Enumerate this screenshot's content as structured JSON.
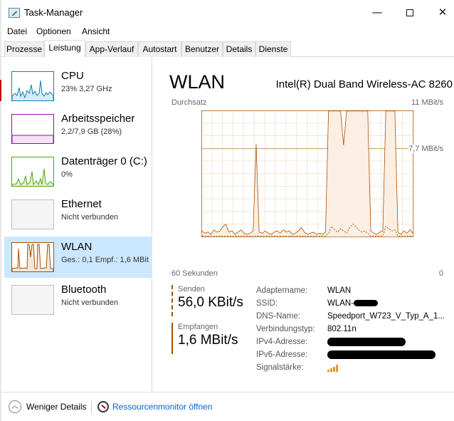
{
  "window": {
    "title": "Task-Manager",
    "minimize": "—",
    "close": "✕"
  },
  "menu": [
    "Datei",
    "Optionen",
    "Ansicht"
  ],
  "tabs": [
    "Prozesse",
    "Leistung",
    "App-Verlauf",
    "Autostart",
    "Benutzer",
    "Details",
    "Dienste"
  ],
  "active_tab": "Leistung",
  "sidebar": [
    {
      "title": "CPU",
      "sub": "23%  3,27 GHz",
      "thumb": "cpu",
      "color": "#117dbb"
    },
    {
      "title": "Arbeitsspeicher",
      "sub": "2,2/7,9 GB (28%)",
      "thumb": "mem",
      "color": "#8b12ae"
    },
    {
      "title": "Datenträger 0 (C:)",
      "sub": "0%",
      "thumb": "disk",
      "color": "#4da60c"
    },
    {
      "title": "Ethernet",
      "sub": "Nicht verbunden",
      "thumb": "none",
      "color": "#bfbfbf"
    },
    {
      "title": "WLAN",
      "sub": "Ges.: 0,1  Empf.: 1,6 MBit",
      "thumb": "wlan",
      "color": "#a74f01",
      "selected": true
    },
    {
      "title": "Bluetooth",
      "sub": "Nicht verbunden",
      "thumb": "none",
      "color": "#bfbfbf"
    }
  ],
  "main": {
    "title": "WLAN",
    "adapter_name": "Intel(R) Dual Band Wireless-AC 8260",
    "throughput_label": "Durchsatz",
    "max_label": "11 MBit/s",
    "mid_label": "7,7 MBit/s",
    "time_label": "60 Sekunden",
    "zero_label": "0",
    "send_label": "Senden",
    "send_value": "56,0 KBit/s",
    "recv_label": "Empfangen",
    "recv_value": "1,6 MBit/s"
  },
  "properties": [
    {
      "key": "Adaptername:",
      "value": "WLAN"
    },
    {
      "key": "SSID:",
      "value": "WLAN-",
      "redacted": true
    },
    {
      "key": "DNS-Name:",
      "value": "Speedport_W723_V_Typ_A_1..."
    },
    {
      "key": "Verbindungstyp:",
      "value": "802.11n"
    },
    {
      "key": "IPv4-Adresse:",
      "value": "",
      "redacted": true
    },
    {
      "key": "IPv6-Adresse:",
      "value": "",
      "redacted": true
    },
    {
      "key": "Signalstärke:",
      "value": "",
      "signal_bars": 4
    }
  ],
  "graph": {
    "max_mbit": 11,
    "receive": [
      0.5,
      0.3,
      0.4,
      0.2,
      0.6,
      0.4,
      0.5,
      0.9,
      1.1,
      0.4,
      0.5,
      0.2,
      0.4,
      0.6,
      0.3,
      0.2,
      0.3,
      0.5,
      8.1,
      0.4,
      0.3,
      0.5,
      0.3,
      0.2,
      0.4,
      0.5,
      0.3,
      0.6,
      0.4,
      0.5,
      0.2,
      0.3,
      0.5,
      0.8,
      0.4,
      0.2,
      0.3,
      0.4,
      0.2,
      0.3,
      0.2,
      0.4,
      11,
      11,
      11,
      11,
      11,
      8.0,
      11,
      11,
      11,
      11,
      11,
      11,
      11,
      11,
      0.5,
      0.3,
      0.2,
      0.4,
      0.5,
      11,
      11,
      11,
      11,
      0.4,
      0.2,
      0.5,
      0.3,
      0.6,
      0.3
    ],
    "send": [
      0.05,
      0.04,
      0.06,
      0.05,
      0.04,
      0.05,
      0.06,
      0.05,
      0.04,
      0.05,
      0.03,
      0.04,
      0.05,
      0.04,
      0.06,
      0.05,
      0.04,
      0.05,
      0.08,
      0.05,
      0.04,
      0.05,
      0.06,
      0.05,
      0.04,
      0.05,
      0.04,
      0.05,
      0.04,
      0.05,
      0.04,
      0.05,
      0.06,
      0.05,
      0.04,
      0.05,
      0.04,
      0.05,
      0.04,
      0.05,
      0.05,
      0.06,
      0.3,
      0.9,
      0.6,
      0.4,
      0.7,
      0.5,
      0.3,
      0.8,
      1.1,
      0.9,
      0.6,
      0.4,
      0.5,
      0.3,
      0.05,
      0.04,
      0.05,
      0.04,
      0.06,
      0.9,
      0.7,
      0.5,
      0.6,
      0.05,
      0.04,
      0.05,
      0.06,
      0.05,
      0.04
    ]
  },
  "footer": {
    "fewer_details": "Weniger Details",
    "resource_monitor": "Ressourcenmonitor öffnen"
  }
}
